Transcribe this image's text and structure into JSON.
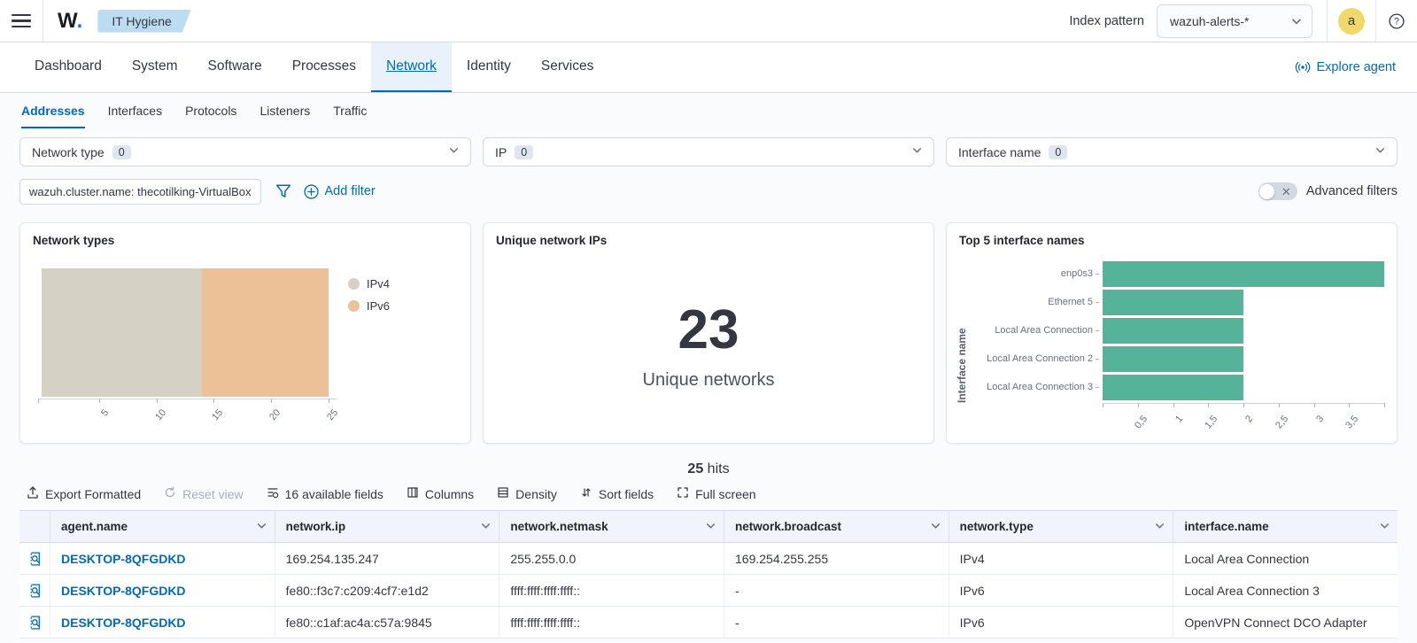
{
  "header": {
    "brand_w": "W",
    "brand_dot": ".",
    "breadcrumb": "IT Hygiene",
    "index_pattern_label": "Index pattern",
    "index_pattern_value": "wazuh-alerts-*",
    "avatar_initial": "a"
  },
  "tabs": {
    "items": [
      "Dashboard",
      "System",
      "Software",
      "Processes",
      "Network",
      "Identity",
      "Services"
    ],
    "active": "Network",
    "explore_agent_label": "Explore agent"
  },
  "subtabs": {
    "items": [
      "Addresses",
      "Interfaces",
      "Protocols",
      "Listeners",
      "Traffic"
    ],
    "active": "Addresses"
  },
  "filters": {
    "dropdowns": [
      {
        "label": "Network type",
        "count": "0"
      },
      {
        "label": "IP",
        "count": "0"
      },
      {
        "label": "Interface name",
        "count": "0"
      }
    ],
    "pill": "wazuh.cluster.name: thecotilking-VirtualBox",
    "add_filter_label": "Add filter",
    "advanced_filters_label": "Advanced filters"
  },
  "colors": {
    "primary_blue": "#006BB4",
    "ipv4": "#d5d1c4",
    "ipv6": "#ecc197",
    "teal_bar": "#54b399",
    "avatar_yellow": "#f0d86b"
  },
  "chart_data": [
    {
      "type": "bar",
      "title": "Network types",
      "orientation": "horizontal-stacked",
      "series": [
        {
          "name": "IPv4",
          "value": 14,
          "color": "#d5d1c4"
        },
        {
          "name": "IPv6",
          "value": 11,
          "color": "#ecc197"
        }
      ],
      "xlim": [
        0,
        25
      ],
      "xticks": [
        5,
        10,
        15,
        20,
        25
      ],
      "legend_position": "right",
      "grid": false
    },
    {
      "type": "metric",
      "title": "Unique network IPs",
      "value": "23",
      "label": "Unique networks"
    },
    {
      "type": "bar",
      "title": "Top 5 interface names",
      "orientation": "horizontal",
      "ylabel": "Interface name",
      "categories": [
        "enp0s3",
        "Ethernet 5",
        "Local Area Connection",
        "Local Area Connection 2",
        "Local Area Connection 3"
      ],
      "values": [
        4,
        2,
        2,
        2,
        2
      ],
      "xlim": [
        0,
        4
      ],
      "xticks": [
        0.5,
        1,
        1.5,
        2,
        2.5,
        3,
        3.5
      ],
      "bar_color": "#54b399",
      "grid": false
    }
  ],
  "table": {
    "hits_count": "25",
    "hits_label": "hits",
    "toolbar": [
      {
        "label": "Export Formatted",
        "icon": "export-icon",
        "disabled": false
      },
      {
        "label": "Reset view",
        "icon": "refresh-icon",
        "disabled": true
      },
      {
        "label": "16 available fields",
        "icon": "fields-icon",
        "disabled": false
      },
      {
        "label": "Columns",
        "icon": "columns-icon",
        "disabled": false
      },
      {
        "label": "Density",
        "icon": "density-icon",
        "disabled": false
      },
      {
        "label": "Sort fields",
        "icon": "sort-icon",
        "disabled": false
      },
      {
        "label": "Full screen",
        "icon": "fullscreen-icon",
        "disabled": false
      }
    ],
    "columns": [
      "agent.name",
      "network.ip",
      "network.netmask",
      "network.broadcast",
      "network.type",
      "interface.name"
    ],
    "rows": [
      [
        "DESKTOP-8QFGDKD",
        "169.254.135.247",
        "255.255.0.0",
        "169.254.255.255",
        "IPv4",
        "Local Area Connection"
      ],
      [
        "DESKTOP-8QFGDKD",
        "fe80::f3c7:c209:4cf7:e1d2",
        "ffff:ffff:ffff:ffff::",
        "-",
        "IPv6",
        "Local Area Connection 3"
      ],
      [
        "DESKTOP-8QFGDKD",
        "fe80::c1af:ac4a:c57a:9845",
        "ffff:ffff:ffff:ffff::",
        "-",
        "IPv6",
        "OpenVPN Connect DCO Adapter"
      ]
    ]
  }
}
